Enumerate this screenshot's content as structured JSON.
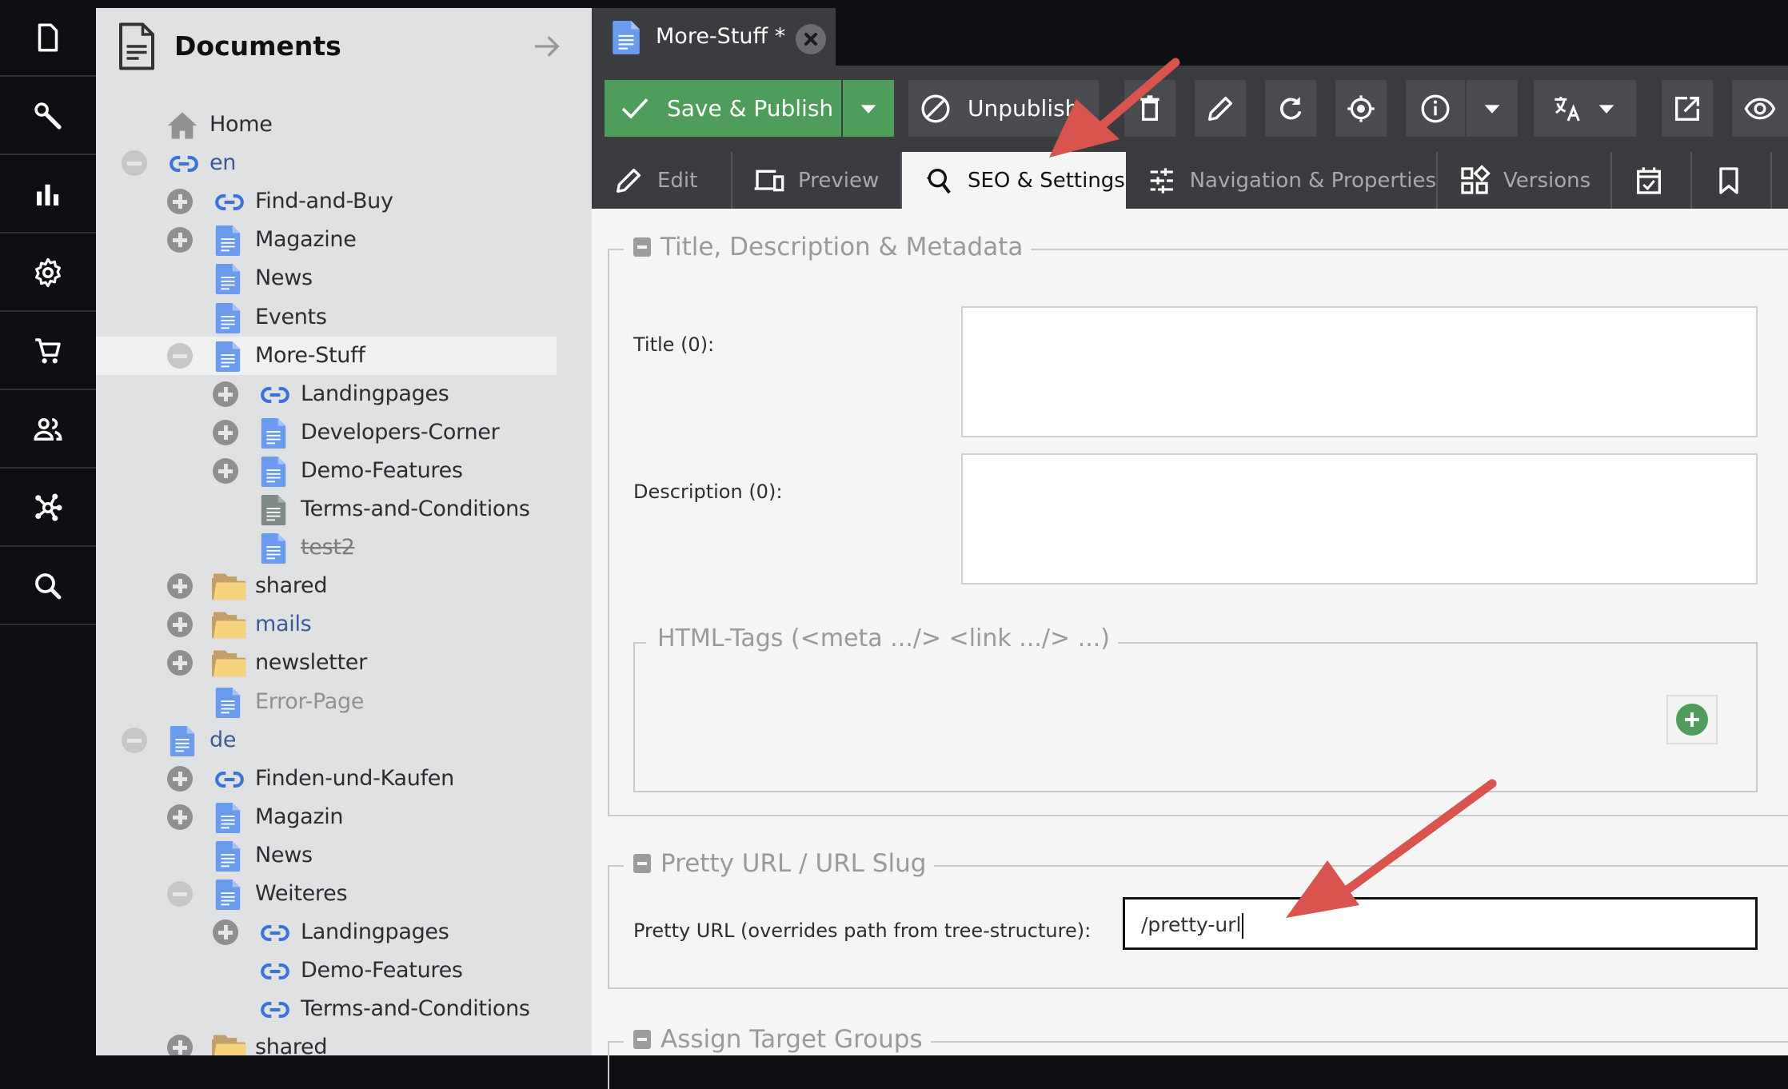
{
  "left_nav": {
    "items": [
      {
        "name": "documents",
        "icon": "document-icon"
      },
      {
        "name": "tools",
        "icon": "wrench-icon"
      },
      {
        "name": "marketing",
        "icon": "bar-chart-icon"
      },
      {
        "name": "settings",
        "icon": "gear-icon"
      },
      {
        "name": "ecommerce",
        "icon": "cart-icon"
      },
      {
        "name": "users",
        "icon": "users-icon"
      },
      {
        "name": "datahub",
        "icon": "network-icon"
      },
      {
        "name": "search",
        "icon": "search-icon"
      }
    ]
  },
  "tree": {
    "title": "Documents",
    "items": [
      {
        "label": "Home",
        "icon": "home",
        "level": 0,
        "toggle": "none",
        "style": "normal"
      },
      {
        "label": "en",
        "icon": "link",
        "level": 0,
        "toggle": "minus",
        "style": "blue"
      },
      {
        "label": "Find-and-Buy",
        "icon": "link",
        "level": 1,
        "toggle": "plus",
        "style": "normal"
      },
      {
        "label": "Magazine",
        "icon": "page",
        "level": 1,
        "toggle": "plus",
        "style": "normal"
      },
      {
        "label": "News",
        "icon": "page",
        "level": 1,
        "toggle": "none",
        "style": "normal"
      },
      {
        "label": "Events",
        "icon": "page",
        "level": 1,
        "toggle": "none",
        "style": "normal"
      },
      {
        "label": "More-Stuff",
        "icon": "page",
        "level": 1,
        "toggle": "minus",
        "style": "normal",
        "selected": true
      },
      {
        "label": "Landingpages",
        "icon": "link",
        "level": 2,
        "toggle": "plus",
        "style": "normal"
      },
      {
        "label": "Developers-Corner",
        "icon": "page",
        "level": 2,
        "toggle": "plus",
        "style": "normal"
      },
      {
        "label": "Demo-Features",
        "icon": "page",
        "level": 2,
        "toggle": "plus",
        "style": "normal"
      },
      {
        "label": "Terms-and-Conditions",
        "icon": "page-grey",
        "level": 2,
        "toggle": "none",
        "style": "normal"
      },
      {
        "label": "test2",
        "icon": "page",
        "level": 2,
        "toggle": "none",
        "style": "strike"
      },
      {
        "label": "shared",
        "icon": "folder",
        "level": 1,
        "toggle": "plus",
        "style": "normal"
      },
      {
        "label": "mails",
        "icon": "folder",
        "level": 1,
        "toggle": "plus",
        "style": "blue"
      },
      {
        "label": "newsletter",
        "icon": "folder",
        "level": 1,
        "toggle": "plus",
        "style": "normal"
      },
      {
        "label": "Error-Page",
        "icon": "page",
        "level": 1,
        "toggle": "none",
        "style": "muted"
      },
      {
        "label": "de",
        "icon": "page",
        "level": 0,
        "toggle": "minus",
        "style": "blue"
      },
      {
        "label": "Finden-und-Kaufen",
        "icon": "link",
        "level": 1,
        "toggle": "plus",
        "style": "normal"
      },
      {
        "label": "Magazin",
        "icon": "page",
        "level": 1,
        "toggle": "plus",
        "style": "normal"
      },
      {
        "label": "News",
        "icon": "page",
        "level": 1,
        "toggle": "none",
        "style": "normal"
      },
      {
        "label": "Weiteres",
        "icon": "page",
        "level": 1,
        "toggle": "minus",
        "style": "normal"
      },
      {
        "label": "Landingpages",
        "icon": "link",
        "level": 2,
        "toggle": "plus",
        "style": "normal"
      },
      {
        "label": "Demo-Features",
        "icon": "link",
        "level": 2,
        "toggle": "none",
        "style": "normal"
      },
      {
        "label": "Terms-and-Conditions",
        "icon": "link",
        "level": 2,
        "toggle": "none",
        "style": "normal"
      },
      {
        "label": "shared",
        "icon": "folder",
        "level": 1,
        "toggle": "plus",
        "style": "normal"
      }
    ]
  },
  "editor": {
    "tab_title": "More-Stuff *",
    "toolbar": {
      "save_publish": "Save & Publish",
      "unpublish": "Unpublish"
    },
    "tabs": [
      {
        "label": "Edit",
        "icon": "pencil-icon"
      },
      {
        "label": "Preview",
        "icon": "devices-icon"
      },
      {
        "label": "SEO & Settings",
        "icon": "seo-search-icon",
        "active": true
      },
      {
        "label": "Navigation & Properties",
        "icon": "sliders-icon"
      },
      {
        "label": "Versions",
        "icon": "versions-icon"
      },
      {
        "label": "",
        "icon": "calendar-check-icon"
      },
      {
        "label": "",
        "icon": "bookmark-icon"
      }
    ],
    "sections": {
      "meta": {
        "title": "Title, Description & Metadata",
        "title_label": "Title (0):",
        "title_value": "",
        "description_label": "Description (0):",
        "description_value": "",
        "html_tags_title": "HTML-Tags (<meta .../> <link .../> ...)"
      },
      "pretty_url": {
        "title": "Pretty URL / URL Slug",
        "label": "Pretty URL (overrides path from tree-structure):",
        "value": "/pretty-url"
      },
      "target_groups": {
        "title": "Assign Target Groups"
      }
    }
  },
  "colors": {
    "accent_green": "#4f9d5a",
    "annotation_red": "#d9534f",
    "link_blue": "#3b73d9",
    "page_blue": "#6a9bec"
  }
}
